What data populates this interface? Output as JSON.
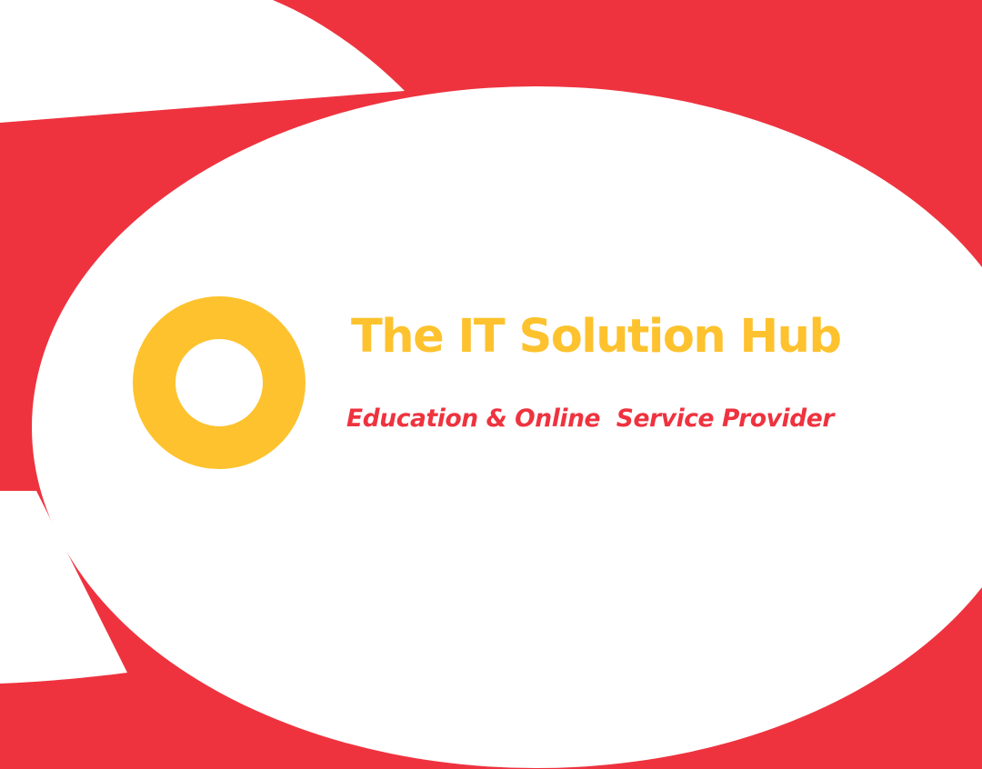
{
  "brand": {
    "title": "The IT Solution Hub",
    "tagline": "Education & Online  Service Provider",
    "logo_icon": "ring-icon"
  },
  "colors": {
    "red": "#EE333F",
    "yellow": "#FDC22D",
    "white": "#FFFFFF"
  }
}
